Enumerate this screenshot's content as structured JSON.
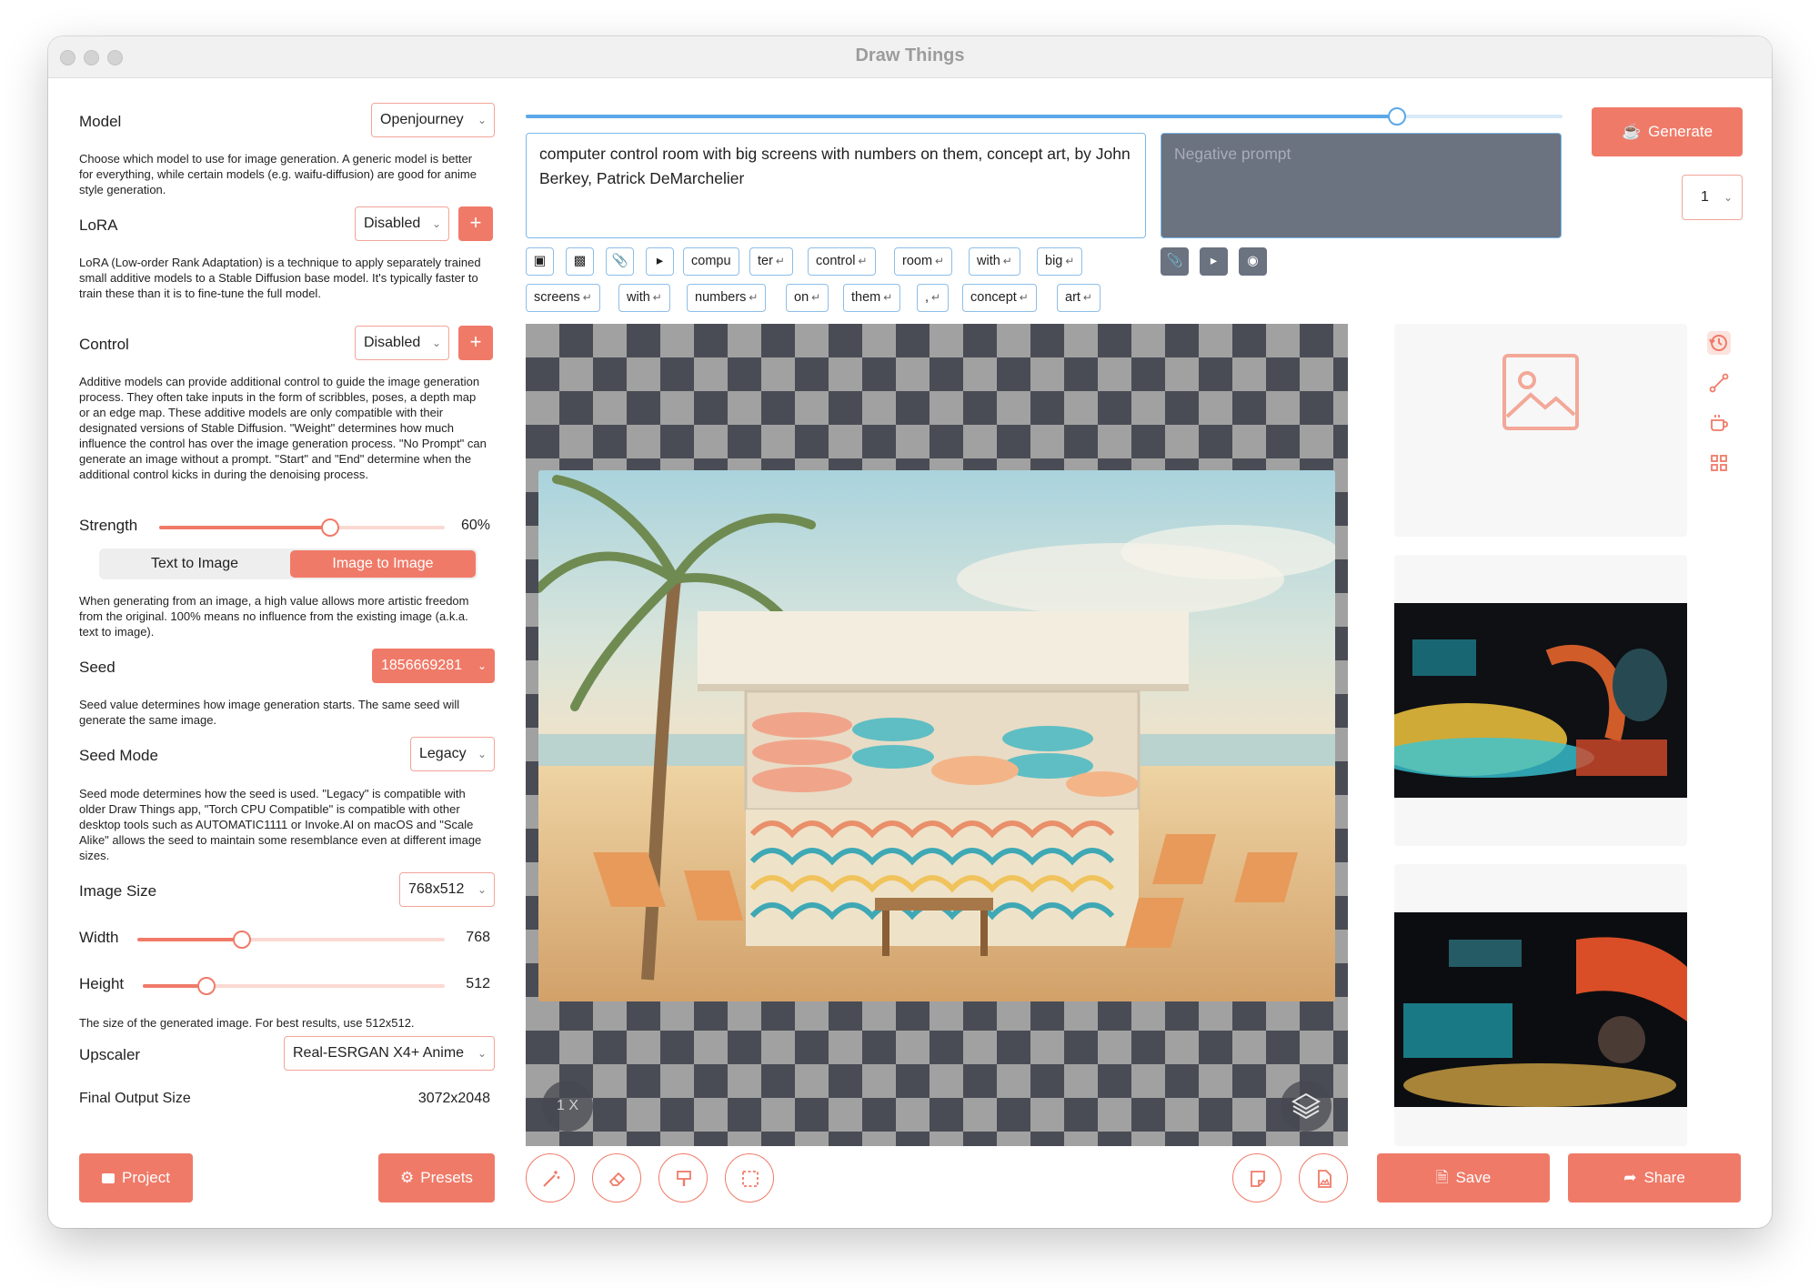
{
  "window": {
    "title": "Draw Things"
  },
  "settings": {
    "model": {
      "label": "Model",
      "value": "Openjourney",
      "description": "Choose which model to use for image generation. A generic model is better for everything, while certain models (e.g. waifu-diffusion) are good for anime style generation."
    },
    "lora": {
      "label": "LoRA",
      "value": "Disabled",
      "description": "LoRA (Low-order Rank Adaptation) is a technique to apply separately trained small additive models to a Stable Diffusion base model. It's typically faster to train these than it is to fine-tune the full model."
    },
    "control": {
      "label": "Control",
      "value": "Disabled",
      "description": "Additive models can provide additional control to guide the image generation process. They often take inputs in the form of scribbles, poses, a depth map or an edge map. These additive models are only compatible with their designated versions of Stable Diffusion. \"Weight\" determines how much influence the control has over the image generation process. \"No Prompt\" can generate an image without a prompt. \"Start\" and \"End\" determine when the additional control kicks in during the denoising process."
    },
    "strength": {
      "label": "Strength",
      "value_text": "60%",
      "fraction": 0.6,
      "modes": [
        "Text to Image",
        "Image to Image"
      ],
      "active_mode": "Image to Image",
      "description": "When generating from an image, a high value allows more artistic freedom from the original. 100% means no influence from the existing image (a.k.a. text to image)."
    },
    "seed": {
      "label": "Seed",
      "value": "1856669281",
      "description": "Seed value determines how image generation starts. The same seed will generate the same image."
    },
    "seed_mode": {
      "label": "Seed Mode",
      "value": "Legacy",
      "description": "Seed mode determines how the seed is used. \"Legacy\" is compatible with older Draw Things app, \"Torch CPU Compatible\" is compatible with other desktop tools such as AUTOMATIC1111 or Invoke.AI on macOS and \"Scale Alike\" allows the seed to maintain some resemblance even at different image sizes."
    },
    "image_size": {
      "label": "Image Size",
      "value": "768x512"
    },
    "width": {
      "label": "Width",
      "value": "768",
      "fraction": 0.34
    },
    "height": {
      "label": "Height",
      "value": "512",
      "fraction": 0.21
    },
    "size_description": "The size of the generated image. For best results, use 512x512.",
    "upscaler": {
      "label": "Upscaler",
      "value": "Real-ESRGAN X4+ Anime"
    },
    "final_output": {
      "label": "Final Output Size",
      "value": "3072x2048"
    }
  },
  "left_buttons": {
    "project": "Project",
    "presets": "Presets"
  },
  "prompt": {
    "text": "computer control room with big screens with numbers on them, concept art, by John Berkey, Patrick DeMarchelier",
    "negative_placeholder": "Negative prompt",
    "progress_fraction": 0.84,
    "tokens_row1": [
      "compu",
      "ter",
      "control",
      "room",
      "with",
      "big"
    ],
    "tokens_row2": [
      "screens",
      "with",
      "numbers",
      "on",
      "them",
      ",",
      "concept",
      "art"
    ],
    "token_return_glyph": "↵",
    "icon_chips": [
      "crop-icon",
      "robot-icon",
      "paperclip-icon",
      "play-icon"
    ],
    "negative_icon_chips": [
      "paperclip-icon",
      "play-icon",
      "record-icon"
    ]
  },
  "generate": {
    "label": "Generate",
    "count": "1"
  },
  "canvas": {
    "zoom": "1 X"
  },
  "tools": [
    "magic-wand-icon",
    "eraser-icon",
    "paint-bucket-icon",
    "selection-icon"
  ],
  "canvas_actions": [
    "note-icon",
    "image-file-icon"
  ],
  "right": {
    "side_icons": [
      "history-icon",
      "curve-icon",
      "coffee-icon",
      "grid-icon"
    ],
    "save": "Save",
    "share": "Share"
  },
  "colors": {
    "accent": "#F07A68",
    "prompt_border": "#7DB8EC",
    "negative_bg": "#6B7280"
  }
}
